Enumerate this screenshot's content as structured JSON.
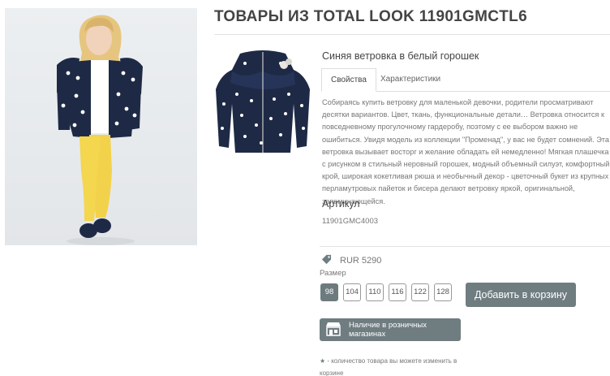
{
  "page": {
    "title": "ТОВАРЫ ИЗ TOTAL LOOK 11901GMCTL6"
  },
  "product": {
    "name": "Синяя ветровка в белый горошек",
    "tabs": [
      {
        "label": "Свойства",
        "active": true
      },
      {
        "label": "Характеристики",
        "active": false
      }
    ],
    "description": "Собираясь купить ветровку для маленькой девочки, родители просматривают десятки вариантов. Цвет, ткань, функциональные детали… Ветровка относится к повседневному прогулочному гардеробу, поэтому с ее выбором важно не ошибиться. Увидя модель из коллекции \"Променад\", у вас не будет сомнений. Эта ветровка вызывает восторг и желание обладать ей немедленно! Мягкая плашечка с рисунком в стильный неровный горошек, модный объемный силуэт, комфортный крой, широкая кокетливая рюша и необычный декор - цветочный букет из крупных перламутровых пайеток и бисера делают ветровку яркой, оригинальной, запоминающейся.",
    "sku_label": "Артикул",
    "sku": "11901GMC4003",
    "price": "RUR 5290",
    "size_label": "Размер",
    "sizes": [
      "98",
      "104",
      "110",
      "116",
      "122",
      "128"
    ],
    "selected_size": "98",
    "add_to_cart": "Добавить в корзину",
    "stores_button": "Наличие в розничных магазинах",
    "note_star": "★",
    "note": " - количество товара вы можете изменить в корзине"
  },
  "colors": {
    "accent": "#6f7d81",
    "jacket": "#1e2a45",
    "pants": "#f2d24a"
  },
  "icons": {
    "price": "price-tag-icon",
    "stores": "store-icon"
  }
}
